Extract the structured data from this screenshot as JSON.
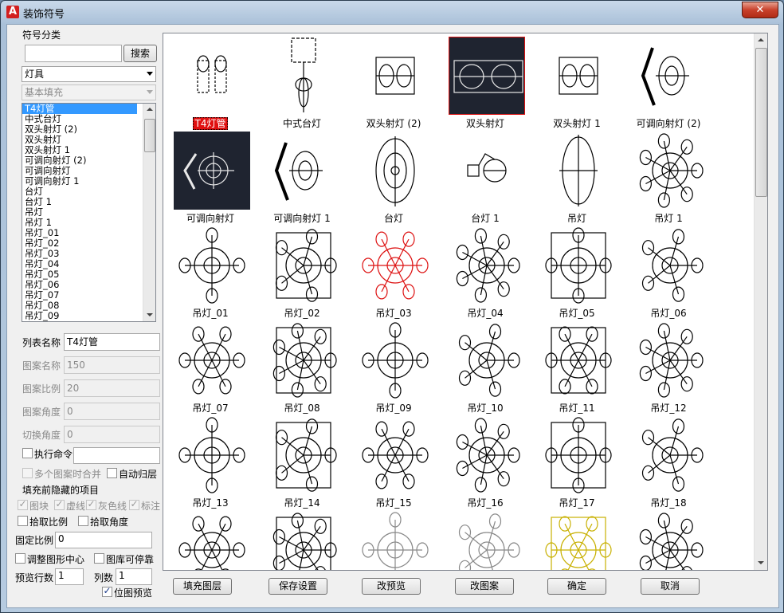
{
  "window": {
    "title": "装饰符号",
    "close_label": "✕"
  },
  "left": {
    "category_title": "符号分类",
    "search_value": "",
    "search_button": "搜索",
    "category_selected": "灯具",
    "subcategory_selected": "基本填充",
    "list_items": [
      "T4灯管",
      "中式台灯",
      "双头射灯 (2)",
      "双头射灯",
      "双头射灯 1",
      "可调向射灯 (2)",
      "可调向射灯",
      "可调向射灯 1",
      "台灯",
      "台灯 1",
      "吊灯",
      "吊灯 1",
      "吊灯_01",
      "吊灯_02",
      "吊灯_03",
      "吊灯_04",
      "吊灯_05",
      "吊灯_06",
      "吊灯_07",
      "吊灯_08",
      "吊灯_09"
    ],
    "list_selected_index": 0,
    "fields": [
      {
        "label": "列表名称",
        "value": "T4灯管",
        "enabled": true
      },
      {
        "label": "图案名称",
        "value": "150",
        "enabled": false
      },
      {
        "label": "图案比例",
        "value": "20",
        "enabled": false
      },
      {
        "label": "图案角度",
        "value": "0",
        "enabled": false
      },
      {
        "label": "切换角度",
        "value": "0",
        "enabled": false
      }
    ],
    "exec_cmd_label": "执行命令",
    "merge_label": "多个图案时合并",
    "auto_layer_label": "自动归层",
    "hidden_items_title": "填充前隐藏的项目",
    "hidden_items": [
      {
        "label": "图块",
        "checked": true
      },
      {
        "label": "虚线",
        "checked": true
      },
      {
        "label": "灰色线",
        "checked": true
      },
      {
        "label": "标注",
        "checked": true
      }
    ],
    "pick_scale_label": "拾取比例",
    "pick_angle_label": "拾取角度",
    "fixed_scale_label": "固定比例",
    "fixed_scale_value": "0",
    "adjust_center_label": "调整图形中心",
    "lib_dock_label": "图库可停靠",
    "preview_rows_label": "预览行数",
    "preview_rows_value": "1",
    "columns_label": "列数",
    "columns_value": "1",
    "bitmap_preview_label": "位图预览",
    "bitmap_preview_checked": true
  },
  "gallery": {
    "items": [
      {
        "label": "T4灯管",
        "highlight": true,
        "dark": false
      },
      {
        "label": "中式台灯",
        "highlight": false,
        "dark": false
      },
      {
        "label": "双头射灯 (2)",
        "highlight": false,
        "dark": false
      },
      {
        "label": "双头射灯",
        "highlight": false,
        "dark": true,
        "redframe": true
      },
      {
        "label": "双头射灯 1",
        "highlight": false,
        "dark": false
      },
      {
        "label": "可调向射灯 (2)",
        "highlight": false,
        "dark": false
      },
      {
        "label": "可调向射灯",
        "highlight": false,
        "dark": true
      },
      {
        "label": "可调向射灯 1",
        "highlight": false,
        "dark": false
      },
      {
        "label": "台灯",
        "highlight": false,
        "dark": false
      },
      {
        "label": "台灯 1",
        "highlight": false,
        "dark": false
      },
      {
        "label": "吊灯",
        "highlight": false,
        "dark": false
      },
      {
        "label": "吊灯 1",
        "highlight": false,
        "dark": false
      },
      {
        "label": "吊灯_01"
      },
      {
        "label": "吊灯_02"
      },
      {
        "label": "吊灯_03",
        "color": "#d11"
      },
      {
        "label": "吊灯_04"
      },
      {
        "label": "吊灯_05"
      },
      {
        "label": "吊灯_06"
      },
      {
        "label": "吊灯_07"
      },
      {
        "label": "吊灯_08"
      },
      {
        "label": "吊灯_09"
      },
      {
        "label": "吊灯_10"
      },
      {
        "label": "吊灯_11"
      },
      {
        "label": "吊灯_12"
      },
      {
        "label": "吊灯_13"
      },
      {
        "label": "吊灯_14"
      },
      {
        "label": "吊灯_15"
      },
      {
        "label": "吊灯_16"
      },
      {
        "label": "吊灯_17"
      },
      {
        "label": "吊灯_18"
      },
      {
        "label": ""
      },
      {
        "label": ""
      },
      {
        "label": "",
        "color": "#888"
      },
      {
        "label": "",
        "color": "#888"
      },
      {
        "label": "",
        "color": "#c8b000"
      },
      {
        "label": ""
      }
    ]
  },
  "buttons": [
    "填充图层",
    "保存设置",
    "改预览",
    "改图案",
    "确定",
    "取消"
  ]
}
